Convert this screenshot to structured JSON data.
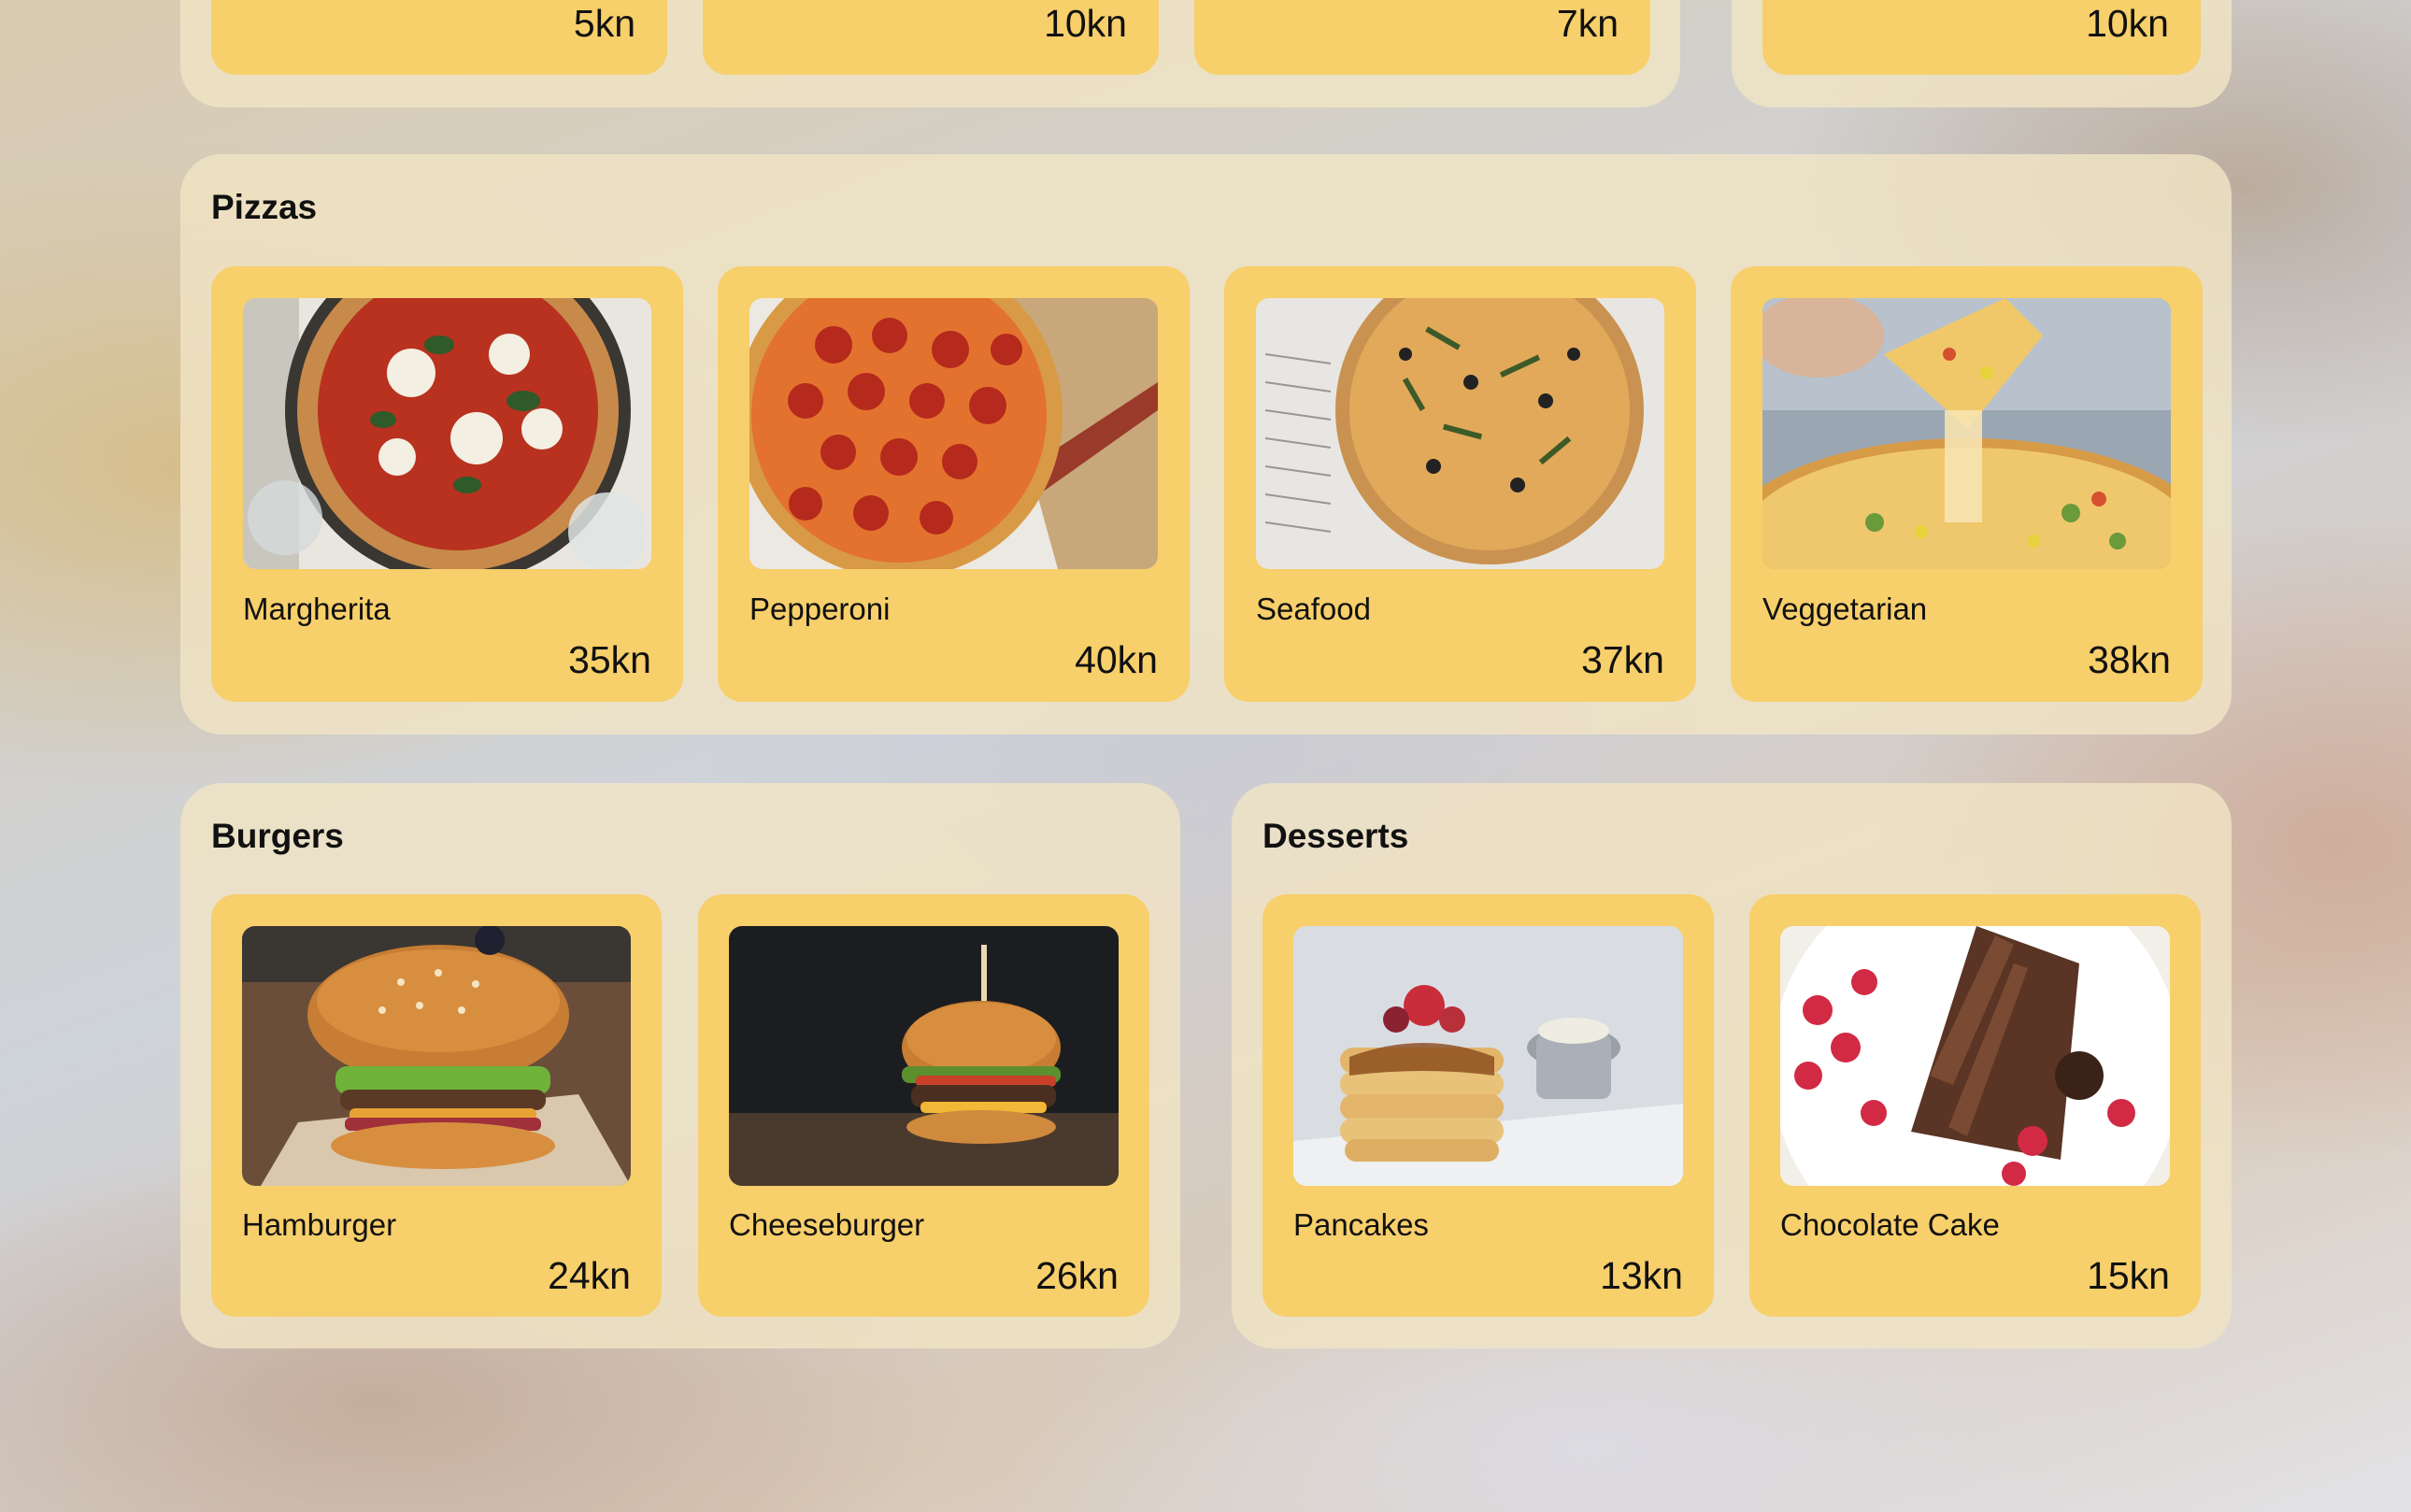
{
  "top_row": {
    "prices": [
      "5kn",
      "10kn",
      "7kn",
      "10kn"
    ]
  },
  "sections": {
    "pizzas": {
      "title": "Pizzas",
      "items": [
        {
          "name": "Margherita",
          "price": "35kn",
          "icon": "pizza-margherita-photo"
        },
        {
          "name": "Pepperoni",
          "price": "40kn",
          "icon": "pizza-pepperoni-photo"
        },
        {
          "name": "Seafood",
          "price": "37kn",
          "icon": "pizza-seafood-photo"
        },
        {
          "name": "Veggetarian",
          "price": "38kn",
          "icon": "pizza-vegetarian-photo"
        }
      ]
    },
    "burgers": {
      "title": "Burgers",
      "items": [
        {
          "name": "Hamburger",
          "price": "24kn",
          "icon": "hamburger-photo"
        },
        {
          "name": "Cheeseburger",
          "price": "26kn",
          "icon": "cheeseburger-photo"
        }
      ]
    },
    "desserts": {
      "title": "Desserts",
      "items": [
        {
          "name": "Pancakes",
          "price": "13kn",
          "icon": "pancakes-photo"
        },
        {
          "name": "Chocolate Cake",
          "price": "15kn",
          "icon": "chocolate-cake-photo"
        }
      ]
    }
  },
  "colors": {
    "section_bg": "#f0e4c4",
    "card_bg": "#f7cf6b",
    "text": "#111111"
  }
}
